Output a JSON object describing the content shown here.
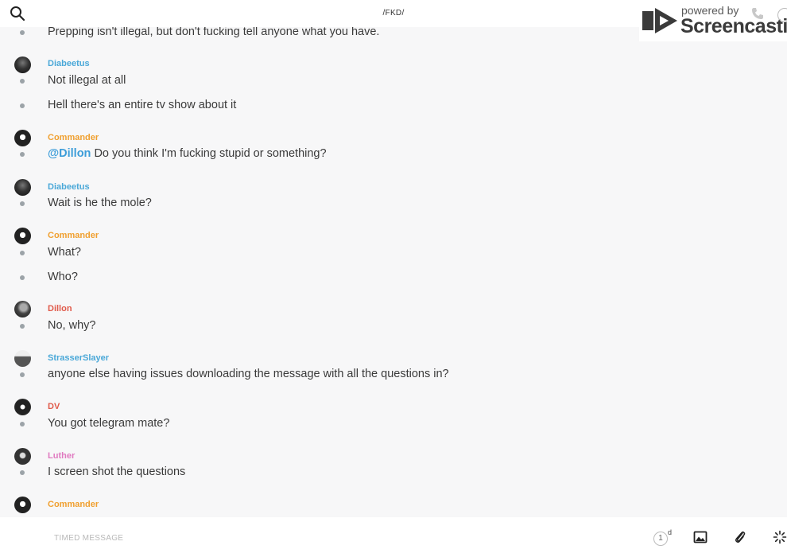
{
  "header": {
    "channel_title": "/FKD/"
  },
  "watermark": {
    "powered_by": "powered by",
    "brand": "Screencastify"
  },
  "messages": [
    {
      "type": "text",
      "text": "Prepping isn't illegal, but don't fucking tell anyone what you have."
    },
    {
      "type": "author",
      "name": "Diabeetus",
      "color": "#4aa8d8"
    },
    {
      "type": "text",
      "text": "Not illegal at all"
    },
    {
      "type": "text",
      "text": "Hell there's an entire tv show about it"
    },
    {
      "type": "author",
      "name": "Commander",
      "color": "#f0a030"
    },
    {
      "type": "text",
      "mention": "@Dillon",
      "text": " Do you think I'm fucking stupid or something?"
    },
    {
      "type": "author",
      "name": "Diabeetus",
      "color": "#4aa8d8"
    },
    {
      "type": "text",
      "text": "Wait is he the mole?"
    },
    {
      "type": "author",
      "name": "Commander",
      "color": "#f0a030"
    },
    {
      "type": "text",
      "text": "What?"
    },
    {
      "type": "text",
      "text": "Who?"
    },
    {
      "type": "author",
      "name": "Dillon",
      "color": "#e05a4a"
    },
    {
      "type": "text",
      "text": "No, why?"
    },
    {
      "type": "author",
      "name": "StrasserSlayer",
      "color": "#4aa8d8"
    },
    {
      "type": "text",
      "text": "anyone else having issues downloading the message with all the questions in?"
    },
    {
      "type": "author",
      "name": "DV",
      "color": "#e05a4a"
    },
    {
      "type": "text",
      "text": "You got telegram mate?"
    },
    {
      "type": "author",
      "name": "Luther",
      "color": "#e07ac0"
    },
    {
      "type": "text",
      "text": "I screen shot the questions"
    },
    {
      "type": "author",
      "name": "Commander",
      "color": "#f0a030"
    }
  ],
  "composer": {
    "placeholder": "TIMED MESSAGE",
    "timer_value": "1",
    "timer_unit": "d"
  },
  "icons": {
    "search": "search-icon",
    "image": "image-icon",
    "attach": "paperclip-icon",
    "loading": "spinner-icon"
  }
}
